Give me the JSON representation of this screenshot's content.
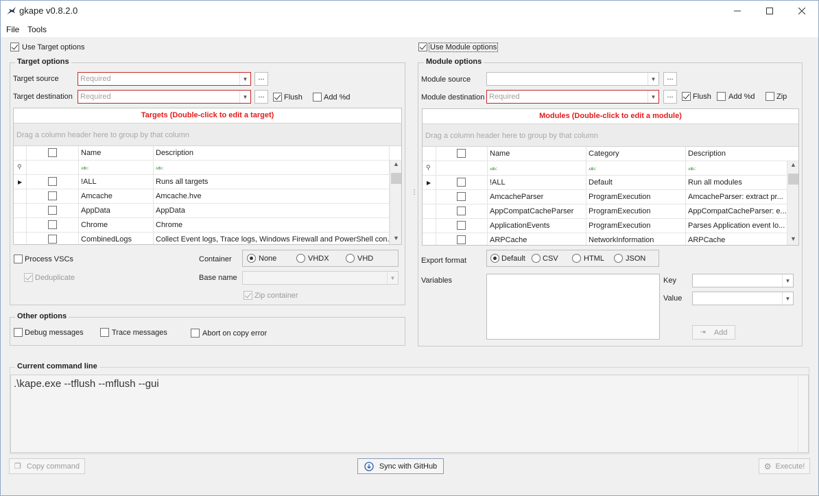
{
  "window": {
    "title": "gkape v0.8.2.0"
  },
  "menu": {
    "file": "File",
    "tools": "Tools"
  },
  "targets": {
    "use_label": "Use Target options",
    "group_title": "Target options",
    "source_label": "Target source",
    "source_placeholder": "Required",
    "dest_label": "Target destination",
    "dest_placeholder": "Required",
    "browse_label": "...",
    "flush_label": "Flush",
    "add_d_label": "Add %d",
    "grid_caption": "Targets (Double-click to edit a target)",
    "group_panel": "Drag a column header here to group by that column",
    "columns": [
      "Name",
      "Description"
    ],
    "rows": [
      {
        "name": "!ALL",
        "description": "Runs all targets"
      },
      {
        "name": "Amcache",
        "description": "Amcache.hve"
      },
      {
        "name": "AppData",
        "description": "AppData"
      },
      {
        "name": "Chrome",
        "description": "Chrome"
      },
      {
        "name": "CombinedLogs",
        "description": "Collect Event logs, Trace logs, Windows Firewall and PowerShell con..."
      }
    ],
    "process_vscs_label": "Process VSCs",
    "deduplicate_label": "Deduplicate",
    "container_label": "Container",
    "container_options": [
      "None",
      "VHDX",
      "VHD"
    ],
    "base_name_label": "Base name",
    "zip_container_label": "Zip container"
  },
  "other": {
    "group_title": "Other options",
    "debug_label": "Debug messages",
    "trace_label": "Trace messages",
    "abort_label": "Abort on copy error"
  },
  "modules": {
    "use_label": "Use Module options",
    "group_title": "Module options",
    "source_label": "Module source",
    "dest_label": "Module destination",
    "dest_placeholder": "Required",
    "browse_label": "...",
    "flush_label": "Flush",
    "add_d_label": "Add %d",
    "zip_label": "Zip",
    "grid_caption": "Modules (Double-click to edit a module)",
    "group_panel": "Drag a column header here to group by that column",
    "columns": [
      "Name",
      "Category",
      "Description"
    ],
    "rows": [
      {
        "name": "!ALL",
        "category": "Default",
        "description": "Run all modules"
      },
      {
        "name": "AmcacheParser",
        "category": "ProgramExecution",
        "description": "AmcacheParser: extract pr..."
      },
      {
        "name": "AppCompatCacheParser",
        "category": "ProgramExecution",
        "description": "AppCompatCacheParser: e..."
      },
      {
        "name": "ApplicationEvents",
        "category": "ProgramExecution",
        "description": "Parses Application event lo..."
      },
      {
        "name": "ARPCache",
        "category": "NetworkInformation",
        "description": "ARPCache"
      }
    ],
    "export_format_label": "Export format",
    "export_options": [
      "Default",
      "CSV",
      "HTML",
      "JSON"
    ],
    "variables_label": "Variables",
    "key_label": "Key",
    "value_label": "Value",
    "add_label": "Add"
  },
  "command": {
    "group_title": "Current command line",
    "text": ".\\kape.exe --tflush --mflush --gui"
  },
  "footer": {
    "copy_label": "Copy command",
    "sync_label": "Sync with GitHub",
    "execute_label": "Execute!"
  }
}
